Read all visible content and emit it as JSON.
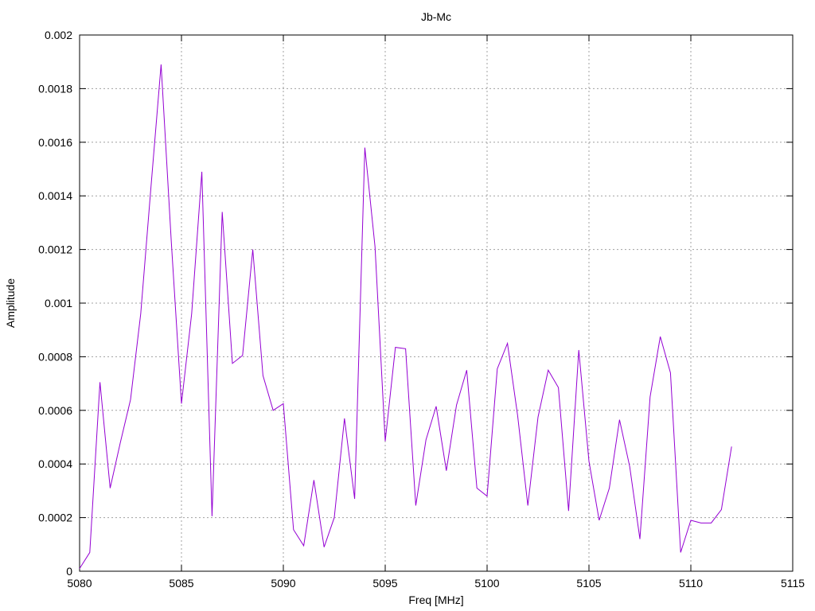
{
  "chart_data": {
    "type": "line",
    "title": "Jb-Mc",
    "xlabel": "Freq [MHz]",
    "ylabel": "Amplitude",
    "xlim": [
      5080,
      5115
    ],
    "ylim": [
      0,
      0.002
    ],
    "xticks": [
      5080,
      5085,
      5090,
      5095,
      5100,
      5105,
      5110,
      5115
    ],
    "xtick_labels": [
      "5080",
      "5085",
      "5090",
      "5095",
      "5100",
      "5105",
      "5110",
      "5115"
    ],
    "yticks": [
      0,
      0.0002,
      0.0004,
      0.0006,
      0.0008,
      0.001,
      0.0012,
      0.0014,
      0.0016,
      0.0018,
      0.002
    ],
    "ytick_labels": [
      "0",
      "0.0002",
      "0.0004",
      "0.0006",
      "0.0008",
      "0.001",
      "0.0012",
      "0.0014",
      "0.0016",
      "0.0018",
      "0.002"
    ],
    "grid": true,
    "legend": "none",
    "series": [
      {
        "color": "#9400d3",
        "x": [
          5080,
          5080.5,
          5081,
          5081.5,
          5082,
          5082.5,
          5083,
          5083.5,
          5084,
          5084.5,
          5085,
          5085.5,
          5086,
          5086.5,
          5087,
          5087.5,
          5088,
          5088.5,
          5089,
          5089.5,
          5090,
          5090.5,
          5091,
          5091.5,
          5092,
          5092.5,
          5093,
          5093.5,
          5094,
          5094.5,
          5095,
          5095.5,
          5096,
          5096.5,
          5097,
          5097.5,
          5098,
          5098.5,
          5099,
          5099.5,
          5100,
          5100.5,
          5101,
          5101.5,
          5102,
          5102.5,
          5103,
          5103.5,
          5104,
          5104.5,
          5105,
          5105.5,
          5106,
          5106.5,
          5107,
          5107.5,
          5108,
          5108.5,
          5109,
          5109.5,
          5110,
          5110.5,
          5111,
          5111.5,
          5112
        ],
        "y": [
          1e-05,
          7e-05,
          0.000705,
          0.00031,
          0.00048,
          0.00064,
          0.00096,
          0.00143,
          0.00189,
          0.00123,
          0.000625,
          0.00096,
          0.00149,
          0.000205,
          0.00134,
          0.000775,
          0.000805,
          0.0012,
          0.00073,
          0.0006,
          0.000625,
          0.000155,
          9.5e-05,
          0.00034,
          9e-05,
          0.0002,
          0.00057,
          0.00027,
          0.00158,
          0.00121,
          0.000485,
          0.000835,
          0.00083,
          0.000245,
          0.00049,
          0.000615,
          0.000375,
          0.00062,
          0.00075,
          0.00031,
          0.00028,
          0.000755,
          0.00085,
          0.00058,
          0.000245,
          0.000575,
          0.00075,
          0.000685,
          0.000225,
          0.000825,
          0.00041,
          0.00019,
          0.00031,
          0.000565,
          0.00039,
          0.00012,
          0.00065,
          0.000875,
          0.00074,
          7e-05,
          0.00019,
          0.00018,
          0.00018,
          0.00023,
          0.000465
        ]
      }
    ]
  }
}
